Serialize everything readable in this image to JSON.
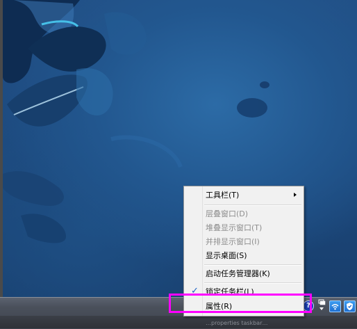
{
  "context_menu": {
    "items": [
      {
        "label": "工具栏(T)",
        "enabled": true,
        "submenu": true
      },
      {
        "label": "层叠窗口(D)",
        "enabled": false
      },
      {
        "label": "堆叠显示窗口(T)",
        "enabled": false
      },
      {
        "label": "并排显示窗口(I)",
        "enabled": false
      },
      {
        "label": "显示桌面(S)",
        "enabled": true
      },
      {
        "label": "启动任务管理器(K)",
        "enabled": true
      },
      {
        "label": "锁定任务栏(L)",
        "enabled": true,
        "checked": true,
        "check_glyph": "✓"
      },
      {
        "label": "属性(R)",
        "enabled": true
      }
    ]
  },
  "taskbar": {
    "tray": {
      "help_glyph": "?",
      "icons": [
        "help-icon",
        "network-up-down-icon",
        "wifi-icon",
        "security-shield-icon"
      ]
    },
    "faint_text": "…properties taskbar…"
  },
  "annotation": {
    "highlight_color": "#ff00ff"
  },
  "colors": {
    "desktop": "#1e4c82",
    "taskbar": "#4a505b",
    "menu_bg": "#f1f1f1",
    "check": "#1d63c5"
  }
}
